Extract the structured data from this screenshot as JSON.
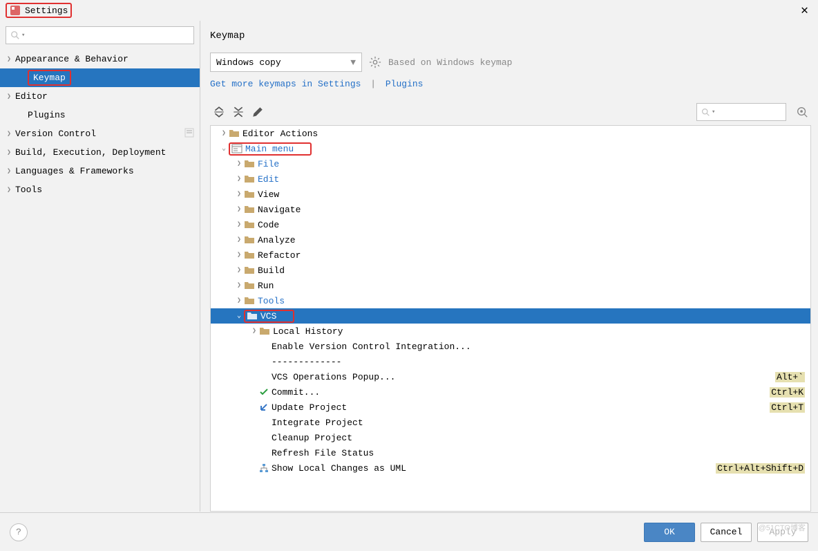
{
  "window": {
    "title": "Settings",
    "close": "✕"
  },
  "sidebar": {
    "items": [
      {
        "label": "Appearance & Behavior",
        "arrow": true
      },
      {
        "label": "Keymap",
        "arrow": false,
        "selected": true,
        "indent": true
      },
      {
        "label": "Editor",
        "arrow": true
      },
      {
        "label": "Plugins",
        "arrow": false,
        "indent": true
      },
      {
        "label": "Version Control",
        "arrow": true,
        "config": true
      },
      {
        "label": "Build, Execution, Deployment",
        "arrow": true
      },
      {
        "label": "Languages & Frameworks",
        "arrow": true
      },
      {
        "label": "Tools",
        "arrow": true
      }
    ]
  },
  "header": {
    "title": "Keymap",
    "scheme": "Windows copy",
    "based_on": "Based on Windows keymap",
    "link1": "Get more keymaps in Settings",
    "link2": "Plugins"
  },
  "tree": [
    {
      "depth": 0,
      "arrow": ">",
      "folder": true,
      "label": "Editor Actions"
    },
    {
      "depth": 0,
      "arrow": "v",
      "menuico": true,
      "label": "Main menu",
      "link": true,
      "redbox": true
    },
    {
      "depth": 1,
      "arrow": ">",
      "folder": true,
      "label": "File",
      "link": true
    },
    {
      "depth": 1,
      "arrow": ">",
      "folder": true,
      "label": "Edit",
      "link": true
    },
    {
      "depth": 1,
      "arrow": ">",
      "folder": true,
      "label": "View"
    },
    {
      "depth": 1,
      "arrow": ">",
      "folder": true,
      "label": "Navigate"
    },
    {
      "depth": 1,
      "arrow": ">",
      "folder": true,
      "label": "Code"
    },
    {
      "depth": 1,
      "arrow": ">",
      "folder": true,
      "label": "Analyze"
    },
    {
      "depth": 1,
      "arrow": ">",
      "folder": true,
      "label": "Refactor"
    },
    {
      "depth": 1,
      "arrow": ">",
      "folder": true,
      "label": "Build"
    },
    {
      "depth": 1,
      "arrow": ">",
      "folder": true,
      "label": "Run"
    },
    {
      "depth": 1,
      "arrow": ">",
      "folder": true,
      "label": "Tools",
      "link": true
    },
    {
      "depth": 1,
      "arrow": "v",
      "folder": true,
      "label": "VCS",
      "selected": true,
      "redbox": true
    },
    {
      "depth": 2,
      "arrow": ">",
      "folder": true,
      "label": "Local History"
    },
    {
      "depth": 2,
      "arrow": "",
      "label": "Enable Version Control Integration..."
    },
    {
      "depth": 2,
      "arrow": "",
      "label": "-------------"
    },
    {
      "depth": 2,
      "arrow": "",
      "label": "VCS Operations Popup...",
      "shortcut": "Alt+`"
    },
    {
      "depth": 2,
      "arrow": "",
      "label": "Commit...",
      "shortcut": "Ctrl+K",
      "check": true
    },
    {
      "depth": 2,
      "arrow": "",
      "label": "Update Project",
      "shortcut": "Ctrl+T",
      "update": true
    },
    {
      "depth": 2,
      "arrow": "",
      "label": "Integrate Project"
    },
    {
      "depth": 2,
      "arrow": "",
      "label": "Cleanup Project"
    },
    {
      "depth": 2,
      "arrow": "",
      "label": "Refresh File Status"
    },
    {
      "depth": 2,
      "arrow": "",
      "label": "Show Local Changes as UML",
      "shortcut": "Ctrl+Alt+Shift+D",
      "uml": true
    }
  ],
  "buttons": {
    "ok": "OK",
    "cancel": "Cancel",
    "apply": "Apply",
    "help": "?"
  },
  "watermark": "@51CTO博客"
}
